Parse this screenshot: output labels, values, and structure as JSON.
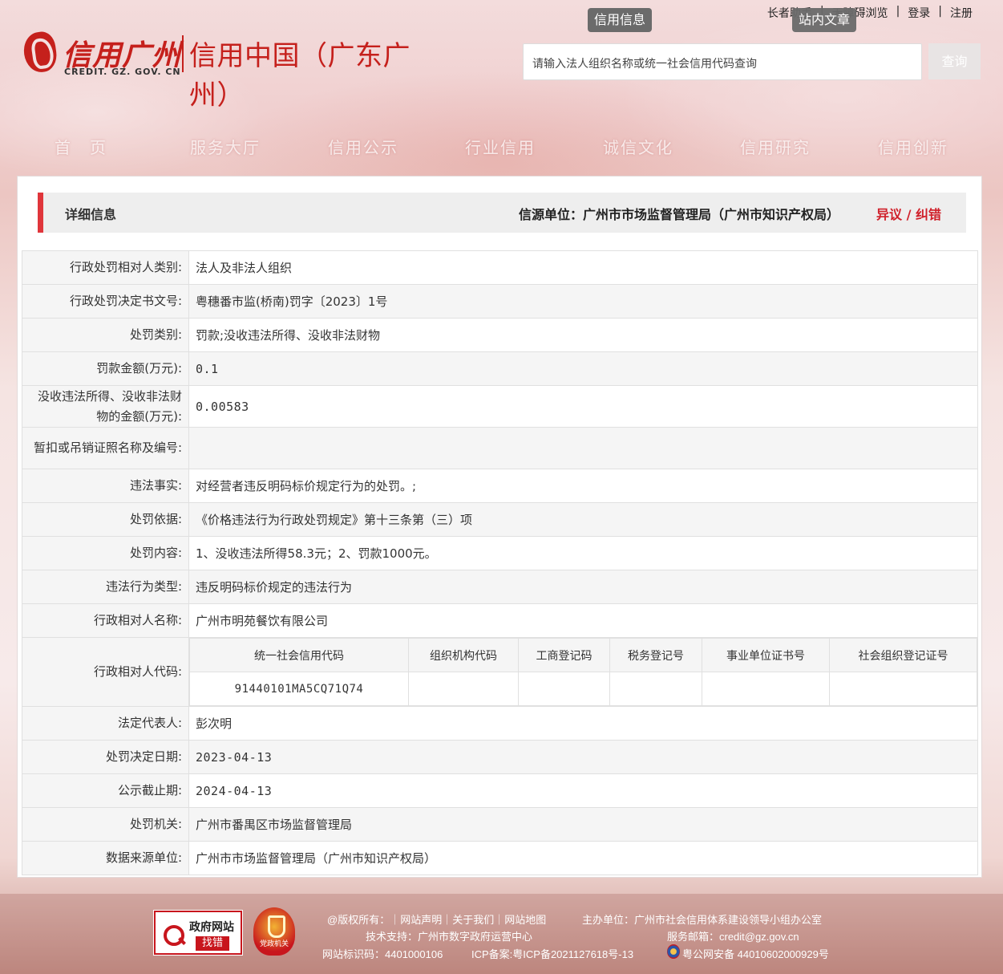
{
  "header": {
    "logo_cn": "信用广州",
    "logo_en": "CREDIT. GZ. GOV. CN",
    "logo_sub": "信用中国（广东广州）",
    "top_links": [
      "长者助手",
      "无障碍浏览",
      "登录",
      "注册"
    ],
    "search_tabs": [
      "信用信息",
      "站内文章"
    ],
    "search_placeholder": "请输入法人组织名称或统一社会信用代码查询",
    "search_button": "查询"
  },
  "nav": [
    "首　页",
    "服务大厅",
    "信用公示",
    "行业信用",
    "诚信文化",
    "信用研究",
    "信用创新"
  ],
  "panel": {
    "title": "详细信息",
    "source": "信源单位：广州市市场监督管理局（广州市知识产权局）",
    "correct": "异议 / 纠错"
  },
  "rows": [
    {
      "label": "行政处罚相对人类别:",
      "value": "法人及非法人组织"
    },
    {
      "label": "行政处罚决定书文号:",
      "value": "粤穗番市监(桥南)罚字〔2023〕1号"
    },
    {
      "label": "处罚类别:",
      "value": "罚款;没收违法所得、没收非法财物"
    },
    {
      "label": "罚款金额(万元):",
      "value": "0.1"
    },
    {
      "label": "没收违法所得、没收非法财物的金额(万元):",
      "value": "0.00583"
    },
    {
      "label": "暂扣或吊销证照名称及编号:",
      "value": ""
    },
    {
      "label": "违法事实:",
      "value": "对经营者违反明码标价规定行为的处罚。;"
    },
    {
      "label": "处罚依据:",
      "value": "《价格违法行为行政处罚规定》第十三条第（三）项"
    },
    {
      "label": "处罚内容:",
      "value": "1、没收违法所得58.3元；2、罚款1000元。"
    },
    {
      "label": "违法行为类型:",
      "value": "违反明码标价规定的违法行为"
    },
    {
      "label": "行政相对人名称:",
      "value": "广州市明苑餐饮有限公司"
    },
    {
      "label": "行政相对人代码:",
      "value": ""
    },
    {
      "label": "法定代表人:",
      "value": "彭次明"
    },
    {
      "label": "处罚决定日期:",
      "value": "2023-04-13"
    },
    {
      "label": "公示截止期:",
      "value": "2024-04-13"
    },
    {
      "label": "处罚机关:",
      "value": "广州市番禺区市场监督管理局"
    },
    {
      "label": "数据来源单位:",
      "value": "广州市市场监督管理局（广州市知识产权局）"
    }
  ],
  "codes": {
    "headers": [
      "统一社会信用代码",
      "组织机构代码",
      "工商登记码",
      "税务登记号",
      "事业单位证书号",
      "社会组织登记证号"
    ],
    "values": [
      "91440101MA5CQ71Q74",
      "",
      "",
      "",
      "",
      ""
    ]
  },
  "footer": {
    "gov_badge_top": "政府网站",
    "gov_badge_bottom": "找错",
    "party_badge": "党政机关",
    "line1_left": "@版权所有：｜网站声明｜关于我们｜网站地图",
    "line1_right": "主办单位：广州市社会信用体系建设领导小组办公室",
    "line2_left": "技术支持：广州市数字政府运营中心",
    "line2_right": "服务邮箱：credit@gz.gov.cn",
    "line3_left": "网站标识码：4401000106",
    "line3_mid": "ICP备案:粤ICP备2021127618号-13",
    "line3_right": "粤公网安备 44010602000929号"
  },
  "colors": {
    "accent": "#e0363b",
    "correct_link": "#d0202a",
    "brand_red": "#c5201c"
  }
}
